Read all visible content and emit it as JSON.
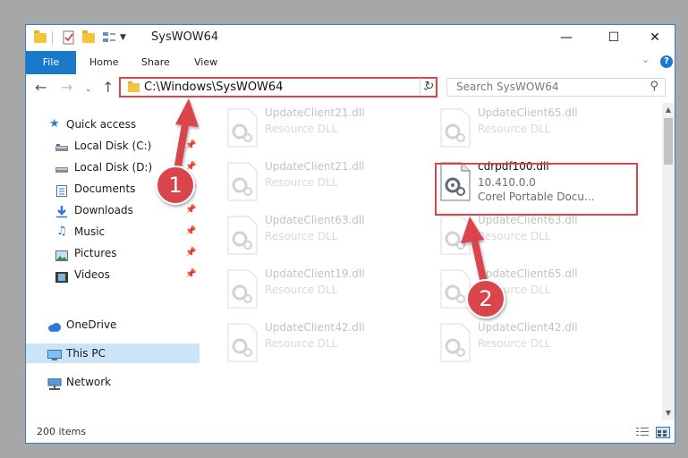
{
  "window": {
    "title": "SysWOW64",
    "controls": {
      "minimize": "—",
      "maximize": "☐",
      "close": "✕"
    }
  },
  "ribbon": {
    "tabs": [
      {
        "label": "File",
        "active": true
      },
      {
        "label": "Home"
      },
      {
        "label": "Share"
      },
      {
        "label": "View"
      }
    ],
    "help": "?"
  },
  "address": {
    "path": "C:\\Windows\\SysWOW64",
    "search_placeholder": "Search SysWOW64"
  },
  "nav": {
    "quick_access": "Quick access",
    "items": [
      {
        "label": "Local Disk (C:)",
        "icon": "drive-icon",
        "pinned": true
      },
      {
        "label": "Local Disk (D:)",
        "icon": "drive-icon",
        "pinned": true
      },
      {
        "label": "Documents",
        "icon": "documents-icon",
        "pinned": true
      },
      {
        "label": "Downloads",
        "icon": "download-icon",
        "pinned": true
      },
      {
        "label": "Music",
        "icon": "music-icon",
        "pinned": true
      },
      {
        "label": "Pictures",
        "icon": "pictures-icon",
        "pinned": true
      },
      {
        "label": "Videos",
        "icon": "videos-icon",
        "pinned": true
      }
    ],
    "onedrive": "OneDrive",
    "this_pc": "This PC",
    "network": "Network"
  },
  "files": {
    "background": [
      {
        "name": "UpdateClient21.dll",
        "type": "Resource DLL"
      },
      {
        "name": "UpdateClient65.dll",
        "type": "Resource DLL"
      },
      {
        "name": "UpdateClient21.dll",
        "type": "Resource DLL"
      },
      {
        "name": "UpdateClient63.dll",
        "type": "Resource DLL"
      },
      {
        "name": "UpdateClient63.dll",
        "type": "Resource DLL"
      },
      {
        "name": "UpdateClient19.dll",
        "type": "Resource DLL"
      },
      {
        "name": "UpdateClient65.dll",
        "type": "Resource DLL"
      },
      {
        "name": "UpdateClient42.dll",
        "type": "Resource DLL"
      },
      {
        "name": "UpdateClient42.dll",
        "type": "Resource DLL"
      }
    ],
    "highlighted": {
      "name": "cdrpdf100.dll",
      "version": "10.410.0.0",
      "description": "Corel Portable Docu..."
    }
  },
  "status": {
    "count": "200 items"
  },
  "annotations": {
    "step1": "1",
    "step2": "2",
    "color": "#d9454b"
  }
}
